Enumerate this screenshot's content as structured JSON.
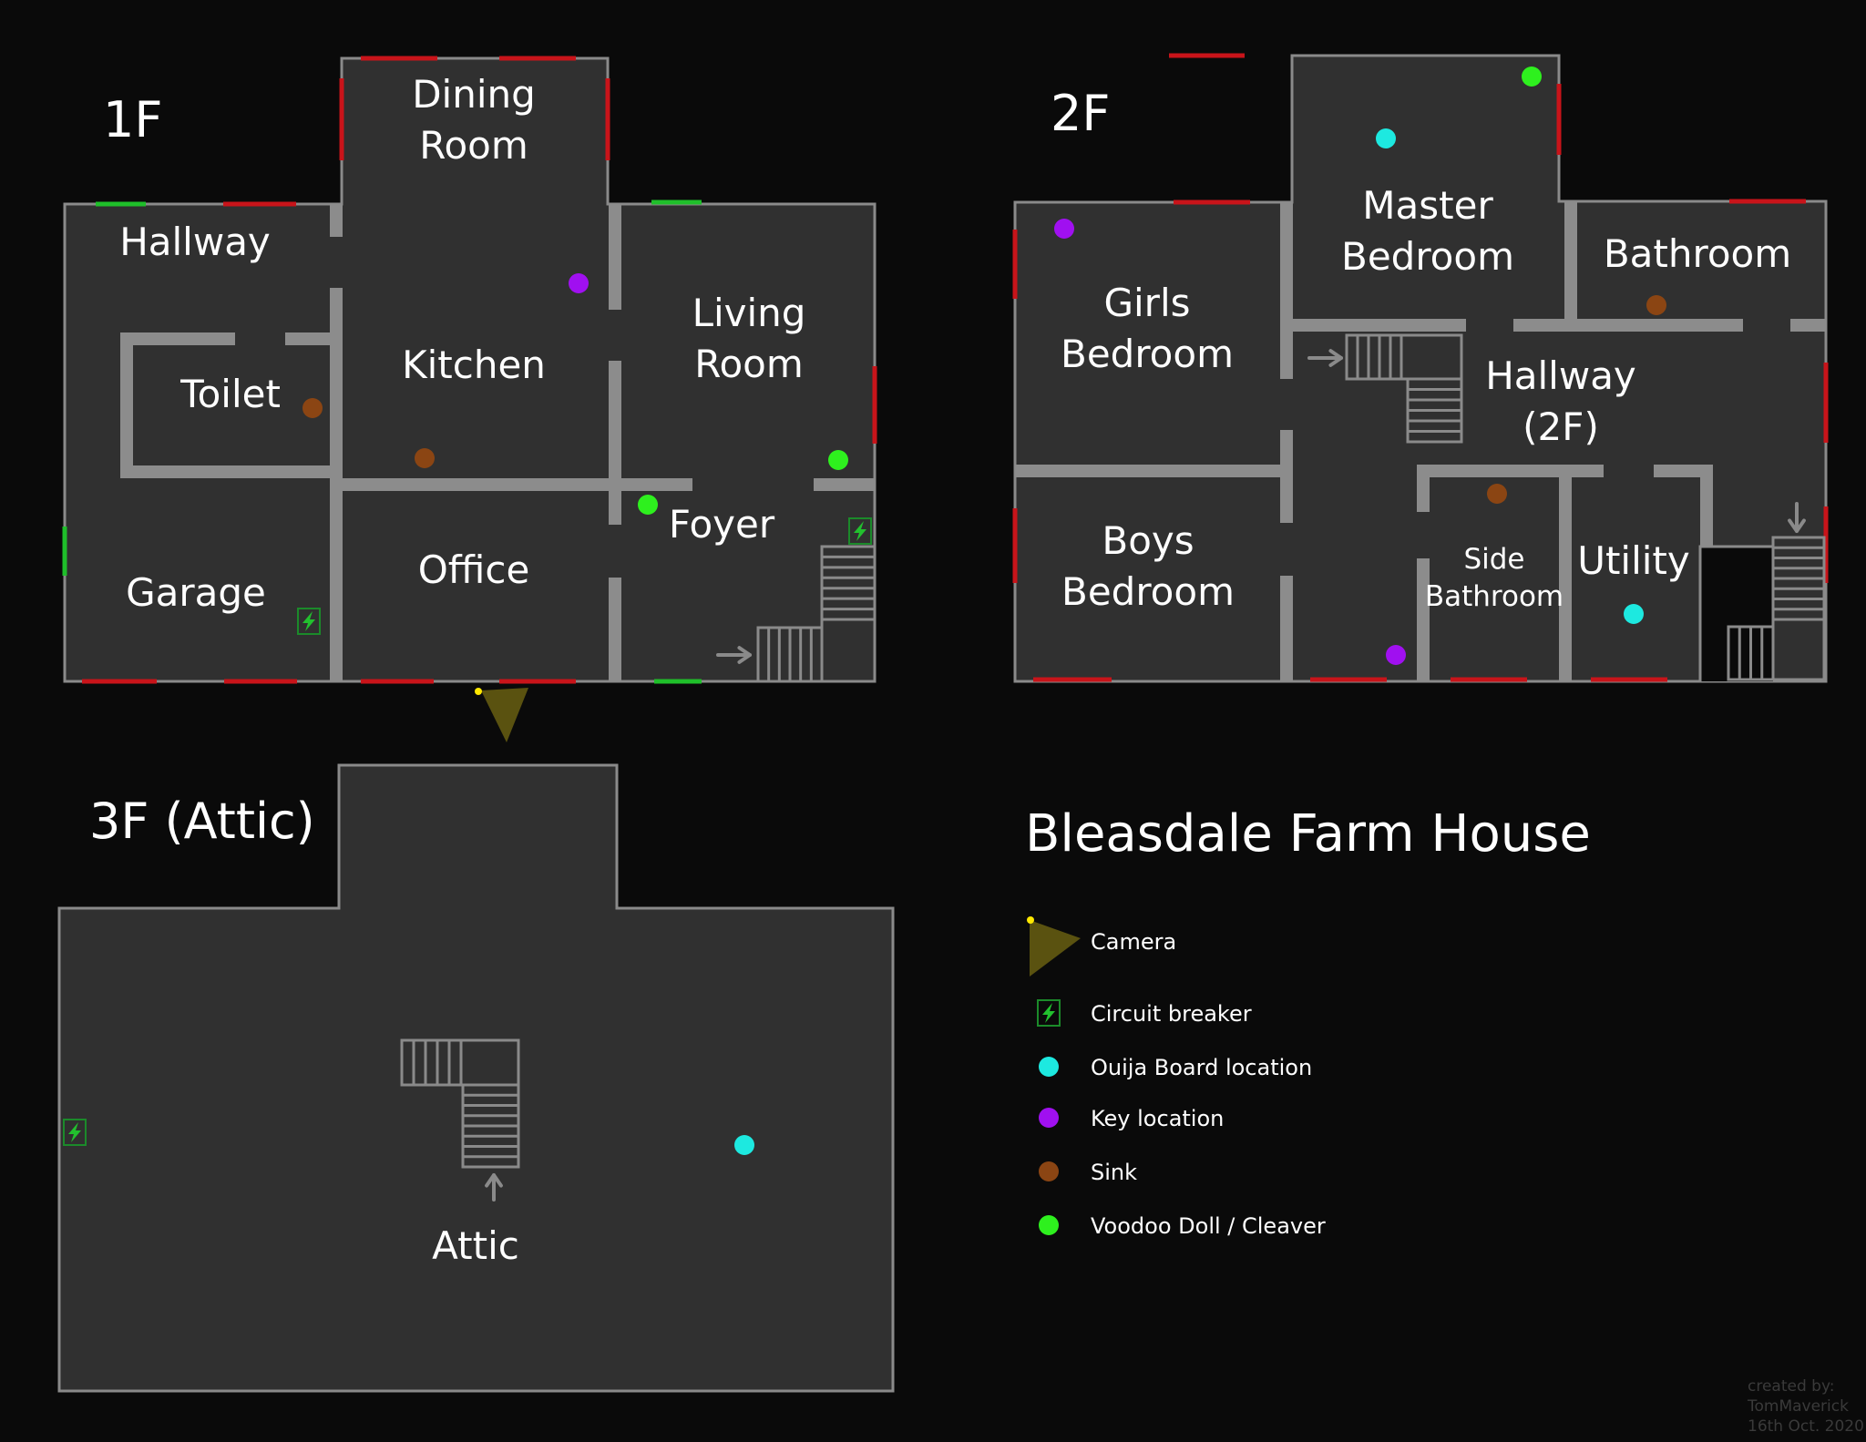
{
  "title": "Bleasdale Farm House",
  "credit": [
    "created by:",
    "TomMaverick",
    "16th Oct. 2020"
  ],
  "colors": {
    "background": "#0a0a0a",
    "floor": "#303030",
    "wall": "#8c8c8c",
    "window_locked": "#c8141a",
    "window_open": "#1fbf2a",
    "camera": "#5a5210",
    "camera_lens": "#ffe800",
    "circuit_breaker": "#22c02e",
    "ouija": "#1de9e0",
    "key": "#a010f0",
    "sink": "#8b4513",
    "voodoo": "#2ef01e"
  },
  "legend": [
    {
      "type": "camera",
      "label": "Camera"
    },
    {
      "type": "breaker",
      "label": "Circuit breaker"
    },
    {
      "type": "ouija",
      "label": "Ouija Board location"
    },
    {
      "type": "key",
      "label": "Key location"
    },
    {
      "type": "sink",
      "label": "Sink"
    },
    {
      "type": "voodoo",
      "label": "Voodoo Doll / Cleaver"
    }
  ],
  "floors": [
    {
      "id": "1F",
      "label": "1F",
      "rooms": [
        "Dining Room",
        "Hallway",
        "Toilet",
        "Kitchen",
        "Living Room",
        "Garage",
        "Office",
        "Foyer"
      ],
      "markers": [
        {
          "type": "key",
          "room": "Kitchen"
        },
        {
          "type": "sink",
          "room": "Toilet"
        },
        {
          "type": "sink",
          "room": "Kitchen"
        },
        {
          "type": "voodoo",
          "room": "Living Room"
        },
        {
          "type": "voodoo",
          "room": "Foyer"
        },
        {
          "type": "breaker",
          "room": "Garage"
        },
        {
          "type": "breaker",
          "room": "Foyer"
        },
        {
          "type": "camera",
          "room": "Outside (front door)"
        }
      ]
    },
    {
      "id": "2F",
      "label": "2F",
      "rooms": [
        "Master Bedroom",
        "Girls Bedroom",
        "Bathroom",
        "Hallway (2F)",
        "Boys Bedroom",
        "Side Bathroom",
        "Utility"
      ],
      "markers": [
        {
          "type": "voodoo",
          "room": "Master Bedroom"
        },
        {
          "type": "ouija",
          "room": "Master Bedroom"
        },
        {
          "type": "key",
          "room": "Girls Bedroom"
        },
        {
          "type": "sink",
          "room": "Bathroom"
        },
        {
          "type": "sink",
          "room": "Side Bathroom"
        },
        {
          "type": "ouija",
          "room": "Utility"
        },
        {
          "type": "key",
          "room": "Hallway (2F)"
        }
      ]
    },
    {
      "id": "3F",
      "label": "3F (Attic)",
      "rooms": [
        "Attic"
      ],
      "markers": [
        {
          "type": "breaker",
          "room": "Attic"
        },
        {
          "type": "ouija",
          "room": "Attic"
        }
      ]
    }
  ]
}
